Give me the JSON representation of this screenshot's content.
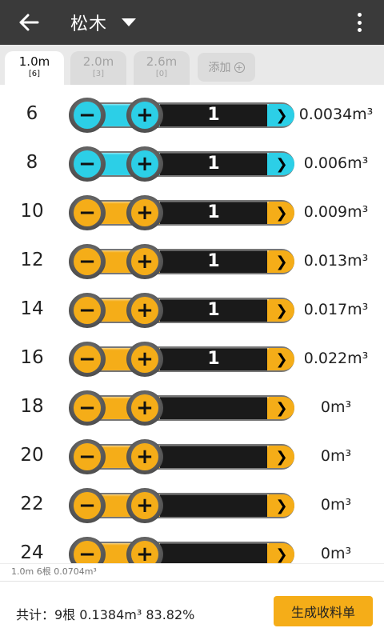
{
  "appbar": {
    "title": "松木",
    "back_icon": "arrow-left-icon",
    "dropdown_icon": "caret-down-icon",
    "menu_icon": "more-vert-icon"
  },
  "tabs": [
    {
      "name": "1.0m",
      "count": "[6]",
      "active": true
    },
    {
      "name": "2.0m",
      "count": "[3]",
      "active": false
    },
    {
      "name": "2.6m",
      "count": "[0]",
      "active": false
    }
  ],
  "add_tab": {
    "label": "添加",
    "icon": "plus-circle-icon"
  },
  "rows": [
    {
      "diameter": "6",
      "count": "1",
      "volume": "0.0034m³",
      "color": "cyan"
    },
    {
      "diameter": "8",
      "count": "1",
      "volume": "0.006m³",
      "color": "cyan"
    },
    {
      "diameter": "10",
      "count": "1",
      "volume": "0.009m³",
      "color": "orange"
    },
    {
      "diameter": "12",
      "count": "1",
      "volume": "0.013m³",
      "color": "orange"
    },
    {
      "diameter": "14",
      "count": "1",
      "volume": "0.017m³",
      "color": "orange"
    },
    {
      "diameter": "16",
      "count": "1",
      "volume": "0.022m³",
      "color": "orange"
    },
    {
      "diameter": "18",
      "count": "",
      "volume": "0m³",
      "color": "orange"
    },
    {
      "diameter": "20",
      "count": "",
      "volume": "0m³",
      "color": "orange"
    },
    {
      "diameter": "22",
      "count": "",
      "volume": "0m³",
      "color": "orange"
    },
    {
      "diameter": "24",
      "count": "",
      "volume": "0m³",
      "color": "orange"
    }
  ],
  "controls": {
    "minus_symbol": "−",
    "plus_symbol": "+",
    "next_symbol": "❯"
  },
  "subtotal": "1.0m 6根 0.0704m³",
  "footer": {
    "total": "共计：9根 0.1384m³ 83.82%",
    "generate_label": "生成收料单"
  },
  "colors": {
    "cyan": "#2ccfe7",
    "orange": "#f5ad18",
    "appbar": "#3a3a3a"
  }
}
